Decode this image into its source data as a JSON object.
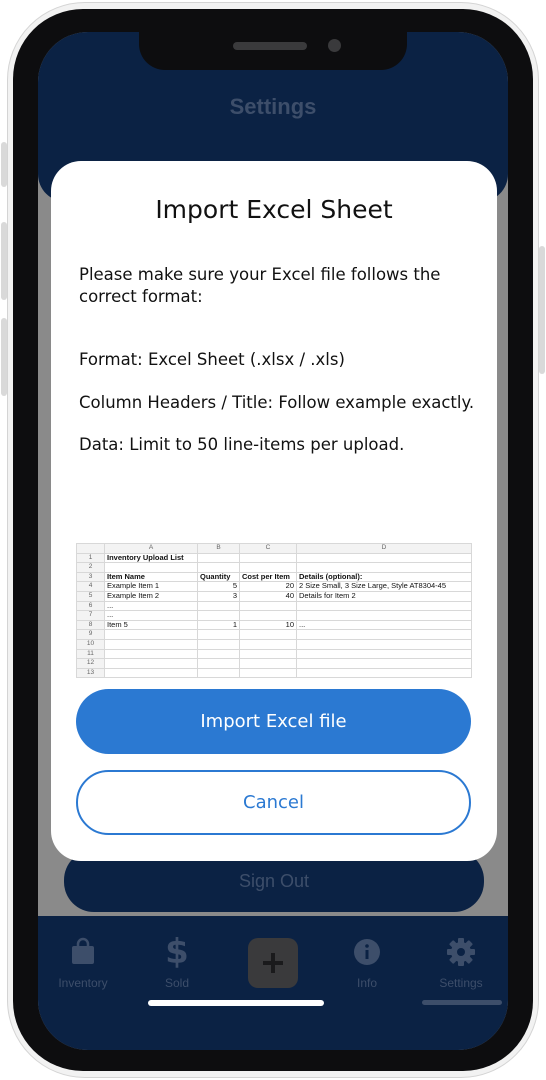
{
  "app": {
    "title": "Settings",
    "signout_label": "Sign Out"
  },
  "tabs": [
    {
      "label": "Inventory",
      "icon": "shopping-bag-icon"
    },
    {
      "label": "Sold",
      "icon": "dollar-icon"
    },
    {
      "label": "",
      "icon": "plus-icon"
    },
    {
      "label": "Info",
      "icon": "info-icon"
    },
    {
      "label": "Settings",
      "icon": "gear-icon"
    }
  ],
  "modal": {
    "title": "Import Excel Sheet",
    "intro": "Please make sure your Excel file follows the correct format:",
    "format": "Format: Excel Sheet (.xlsx / .xls)",
    "headers": "Column Headers / Title: Follow example exactly.",
    "data_limit": "Data: Limit to 50 line-items per upload.",
    "import_label": "Import Excel file",
    "cancel_label": "Cancel"
  },
  "sheet": {
    "columns": [
      "A",
      "B",
      "C",
      "D"
    ],
    "title": "Inventory Upload List",
    "headers": [
      "Item Name",
      "Quantity",
      "Cost per Item",
      "Details (optional):"
    ],
    "rows": [
      {
        "num": "1",
        "cells": [
          "Inventory Upload List",
          "",
          "",
          ""
        ]
      },
      {
        "num": "2",
        "cells": [
          "",
          "",
          "",
          ""
        ]
      },
      {
        "num": "3",
        "cells": [
          "Item Name",
          "Quantity",
          "Cost per Item",
          "Details (optional):"
        ]
      },
      {
        "num": "4",
        "cells": [
          "Example Item 1",
          "5",
          "20",
          "2 Size Small, 3 Size Large, Style AT8304-45"
        ]
      },
      {
        "num": "5",
        "cells": [
          "Example Item 2",
          "3",
          "40",
          "Details for Item 2"
        ]
      },
      {
        "num": "6",
        "cells": [
          "...",
          "",
          "",
          ""
        ]
      },
      {
        "num": "7",
        "cells": [
          "...",
          "",
          "",
          ""
        ]
      },
      {
        "num": "8",
        "cells": [
          "Item 5",
          "1",
          "10",
          "..."
        ]
      },
      {
        "num": "9",
        "cells": [
          "",
          "",
          "",
          ""
        ]
      },
      {
        "num": "10",
        "cells": [
          "",
          "",
          "",
          ""
        ]
      },
      {
        "num": "11",
        "cells": [
          "",
          "",
          "",
          ""
        ]
      },
      {
        "num": "12",
        "cells": [
          "",
          "",
          "",
          ""
        ]
      },
      {
        "num": "13",
        "cells": [
          "",
          "",
          "",
          ""
        ]
      }
    ]
  },
  "colors": {
    "accent": "#2b79d2",
    "app_navy": "#0b2244",
    "overlay_gray": "#8a8a8a"
  }
}
